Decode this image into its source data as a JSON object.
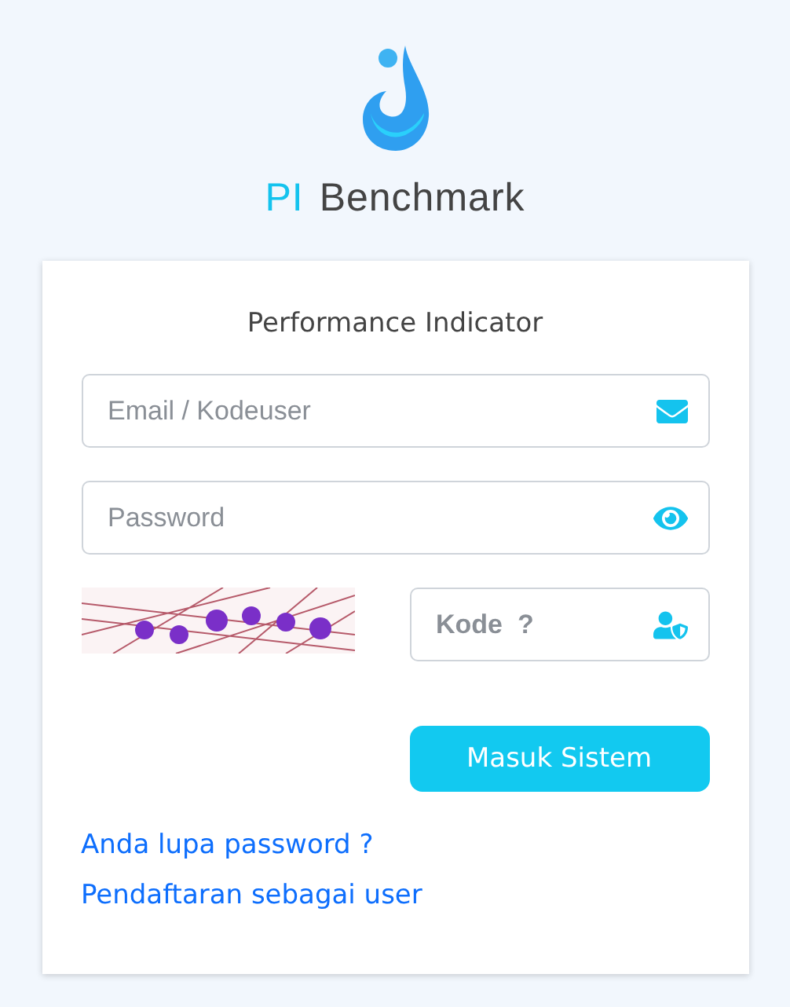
{
  "brand": {
    "prefix": "PI",
    "name": "Benchmark"
  },
  "card": {
    "title": "Performance Indicator",
    "email": {
      "placeholder": "Email / Kodeuser"
    },
    "password": {
      "placeholder": "Password"
    },
    "code": {
      "placeholder": "Kode  ?"
    },
    "submit": "Masuk Sistem",
    "links": [
      "Anda lupa password ?",
      "Pendaftaran sebagai user"
    ]
  }
}
